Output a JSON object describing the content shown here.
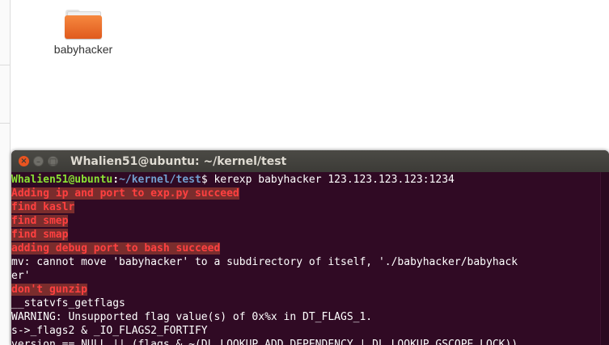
{
  "desktop": {
    "icon_label": "babyhacker"
  },
  "terminal": {
    "title": "Whalien51@ubuntu: ~/kernel/test",
    "buttons": {
      "close": "×",
      "minimize": "–",
      "maximize": "□"
    },
    "prompt": {
      "user": "Whalien51@ubuntu",
      "sep": ":",
      "path": "~/kernel/test",
      "symbol": "$ ",
      "command": "kerexp babyhacker 123.123.123.123:1234"
    },
    "lines": [
      "Adding ip and port to exp.py succeed",
      "find kaslr",
      "find smep",
      "find smap",
      "adding debug port to bash succeed",
      "mv: cannot move 'babyhacker' to a subdirectory of itself, './babyhacker/babyhack",
      "er'",
      "don't gunzip",
      "__statvfs_getflags",
      "WARNING: Unsupported flag value(s) of 0x%x in DT_FLAGS_1.",
      "s->_flags2 & _IO_FLAGS2_FORTIFY",
      "version == NULL || (flags & ~(DL_LOOKUP_ADD_DEPENDENCY | DL_LOOKUP_GSCOPE_LOCK))"
    ],
    "colors": {
      "background": "#300a24",
      "prompt_user": "#8ae234",
      "prompt_path": "#729fcf",
      "error_text": "#ff4040",
      "error_highlight": "#7a2d2d"
    }
  }
}
